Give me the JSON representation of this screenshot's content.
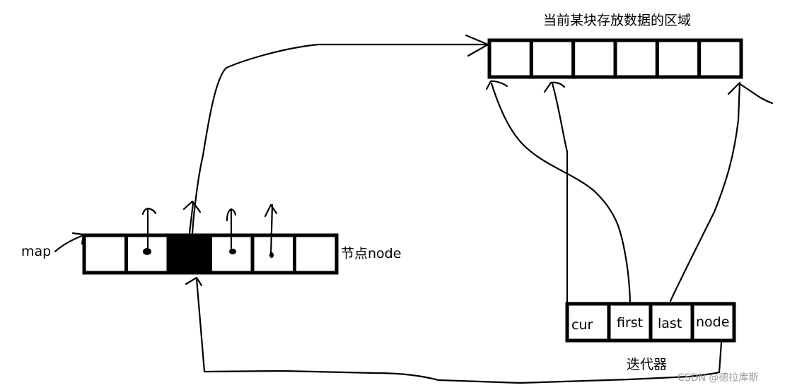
{
  "title": "当前某块存放数据的区域",
  "map_label": "map",
  "node_label": "节点node",
  "iterator_label": "迭代器",
  "iterator_fields": [
    "cur",
    "first",
    "last",
    "node"
  ],
  "buffer_cell_count": 6,
  "map_cell_count": 6,
  "map_current_cell_index": 2,
  "watermark": "CSDN @德拉库斯",
  "colors": {
    "ink": "#000000",
    "background": "#ffffff",
    "watermark": "#9a9a9a"
  }
}
